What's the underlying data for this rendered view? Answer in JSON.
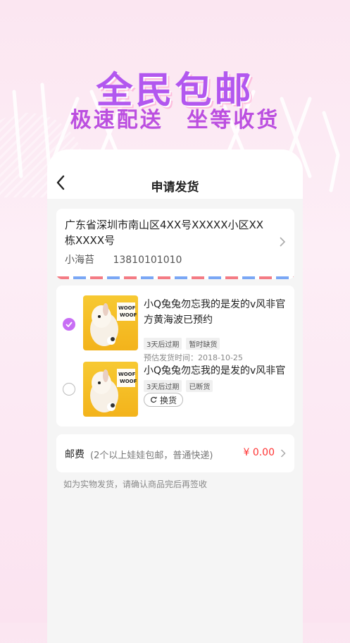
{
  "banner": {
    "headline": "全民包邮",
    "sub_left": "极速配送",
    "sub_right": "坐等收货"
  },
  "navbar": {
    "title": "申请发货",
    "back_icon": "chevron-left-icon"
  },
  "address": {
    "line": "广东省深圳市南山区4XX号XXXXX小区XX栋XXXX号",
    "name": "小海苔",
    "phone": "13810101010"
  },
  "goods": [
    {
      "name": "小Q兔兔勿忘我的是发的v风非官方黄海波已预约",
      "tags": [
        "3天后过期",
        "暂时缺货"
      ],
      "eta": "预估发货时间：2018-10-25",
      "selected": true
    },
    {
      "name": "小Q兔兔勿忘我的是发的v风非官",
      "tags": [
        "3天后过期",
        "已断货"
      ],
      "swap_label": "换货",
      "selected": false
    }
  ],
  "shipping": {
    "label": "邮费",
    "desc": "(2个以上娃娃包邮，普通快递)",
    "price": "¥ 0.00"
  },
  "notice": "如为实物发货，请确认商品完后再签收",
  "colors": {
    "accent": "#c86ef5",
    "price": "#ff3333",
    "headline": "#b257ef"
  }
}
